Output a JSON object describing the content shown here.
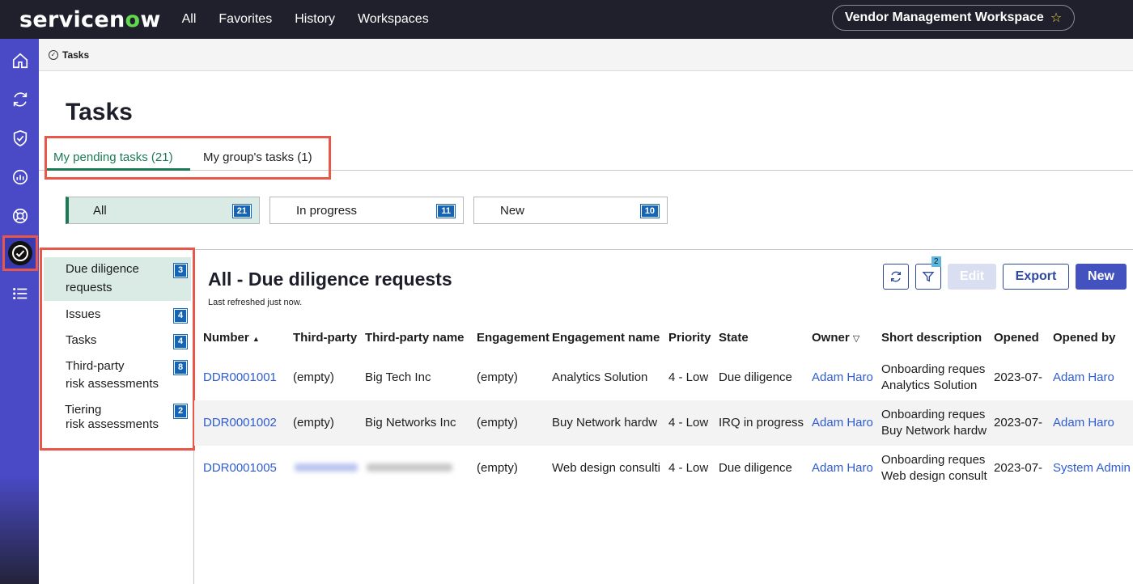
{
  "topbar": {
    "logo_text": "servicenow",
    "nav": [
      "All",
      "Favorites",
      "History",
      "Workspaces"
    ],
    "workspace_label": "Vendor Management Workspace",
    "star_icon": "star-outline-icon"
  },
  "rail": {
    "icons": [
      "home-icon",
      "refresh-icon",
      "shield-check-icon",
      "analytics-icon",
      "support-icon",
      "check-circle-icon",
      "list-icon"
    ],
    "active": "check-circle-icon"
  },
  "breadcrumb": {
    "label": "Tasks"
  },
  "page": {
    "title": "Tasks"
  },
  "tabs": [
    {
      "label": "My pending tasks (21)",
      "active": true
    },
    {
      "label": "My group's tasks (1)",
      "active": false
    }
  ],
  "filters": [
    {
      "label": "All",
      "count": "21",
      "active": true
    },
    {
      "label": "In progress",
      "count": "11",
      "active": false
    },
    {
      "label": "New",
      "count": "10",
      "active": false
    }
  ],
  "side_list": [
    {
      "line1": "Due diligence",
      "line2": "requests",
      "count": "3",
      "active": true
    },
    {
      "line1": "Issues",
      "line2": "",
      "count": "4",
      "active": false
    },
    {
      "line1": "Tasks",
      "line2": "",
      "count": "4",
      "active": false
    },
    {
      "line1": "Third-party",
      "line2": "risk assessments",
      "count": "8",
      "active": false
    },
    {
      "line1": "Tiering",
      "line2": "risk assessments",
      "count": "2",
      "active": false
    }
  ],
  "list": {
    "title": "All - Due diligence requests",
    "refreshed": "Last refreshed just now.",
    "filter_badge": "2",
    "buttons": {
      "edit": "Edit",
      "export": "Export",
      "new": "New"
    },
    "columns": [
      "Number",
      "Third-party",
      "Third-party name",
      "Engagement",
      "Engagement name",
      "Priority",
      "State",
      "Owner",
      "Short description",
      "Opened",
      "Opened by"
    ],
    "rows": [
      {
        "number": "DDR0001001",
        "third_party": "(empty)",
        "third_party_name": "Big Tech Inc",
        "engagement": "(empty)",
        "engagement_name": "Analytics Solution",
        "priority": "4 - Low",
        "state": "Due diligence",
        "owner": "Adam Haro",
        "desc1": "Onboarding reques",
        "desc2": "Analytics Solution",
        "opened": "2023-07-",
        "opened_by": "Adam Haro"
      },
      {
        "number": "DDR0001002",
        "third_party": "(empty)",
        "third_party_name": "Big Networks Inc",
        "engagement": "(empty)",
        "engagement_name": "Buy Network hardw",
        "priority": "4 - Low",
        "state": "IRQ in progress",
        "owner": "Adam Haro",
        "desc1": "Onboarding reques",
        "desc2": "Buy Network hardw",
        "opened": "2023-07-",
        "opened_by": "Adam Haro"
      },
      {
        "number": "DDR0001005",
        "third_party": "",
        "third_party_name": "",
        "engagement": "(empty)",
        "engagement_name": "Web design consulti",
        "priority": "4 - Low",
        "state": "Due diligence",
        "owner": "Adam Haro",
        "desc1": "Onboarding reques",
        "desc2": "Web design consult",
        "opened": "2023-07-",
        "opened_by": "System Admin"
      }
    ]
  },
  "colors": {
    "accent_green": "#1b7a55",
    "brand_purple": "#4a4ac7",
    "link_blue": "#2e5bd6",
    "highlight_red": "#e8574a",
    "badge_blue": "#1665b5"
  }
}
